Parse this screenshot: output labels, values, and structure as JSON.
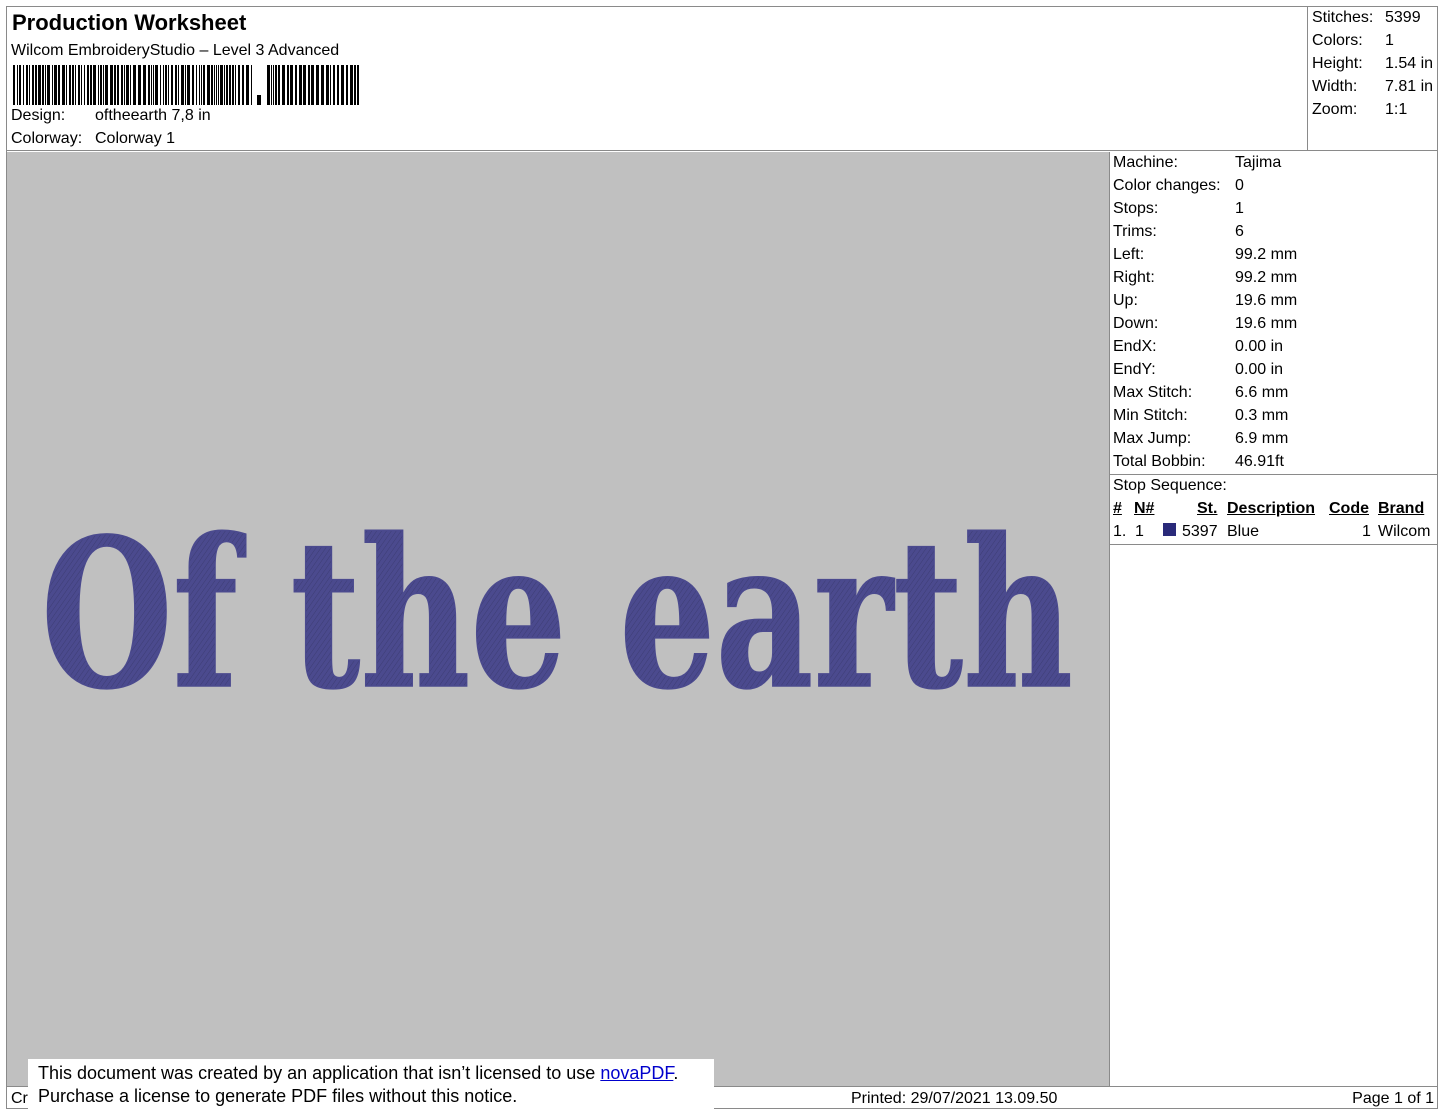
{
  "header": {
    "title": "Production Worksheet",
    "subtitle": "Wilcom EmbroideryStudio – Level 3 Advanced",
    "design_label": "Design:",
    "design_value": "oftheearth 7,8 in",
    "colorway_label": "Colorway:",
    "colorway_value": "Colorway 1"
  },
  "summary": {
    "stitches_label": "Stitches:",
    "stitches_value": "5399",
    "colors_label": "Colors:",
    "colors_value": "1",
    "height_label": "Height:",
    "height_value": "1.54 in",
    "width_label": "Width:",
    "width_value": "7.81 in",
    "zoom_label": "Zoom:",
    "zoom_value": "1:1"
  },
  "machine_info": [
    {
      "label": "Machine:",
      "value": "Tajima"
    },
    {
      "label": "Color changes:",
      "value": "0"
    },
    {
      "label": "Stops:",
      "value": "1"
    },
    {
      "label": "Trims:",
      "value": "6"
    },
    {
      "label": "Left:",
      "value": "99.2 mm"
    },
    {
      "label": "Right:",
      "value": "99.2 mm"
    },
    {
      "label": "Up:",
      "value": "19.6 mm"
    },
    {
      "label": "Down:",
      "value": "19.6 mm"
    },
    {
      "label": "EndX:",
      "value": "0.00 in"
    },
    {
      "label": "EndY:",
      "value": "0.00 in"
    },
    {
      "label": "Max Stitch:",
      "value": "6.6 mm"
    },
    {
      "label": "Min Stitch:",
      "value": "0.3 mm"
    },
    {
      "label": "Max Jump:",
      "value": "6.9 mm"
    },
    {
      "label": "Total Bobbin:",
      "value": "46.91ft"
    }
  ],
  "stop_sequence": {
    "title": "Stop Sequence:",
    "headers": {
      "num": "#",
      "n": "N#",
      "st": "St.",
      "description": "Description",
      "code": "Code",
      "brand": "Brand"
    },
    "rows": [
      {
        "num": "1.",
        "n": "1",
        "color": "#2a2a7a",
        "st": "5397",
        "description": "Blue",
        "code": "1",
        "brand": "Wilcom"
      }
    ]
  },
  "design": {
    "text": "Of the earth",
    "thread_color": "#4b4a8e",
    "background_color": "#c0c0c0"
  },
  "footer": {
    "left": "Cr",
    "printed": "Printed: 29/07/2021 13.09.50",
    "page": "Page 1 of 1"
  },
  "notice": {
    "line1_prefix": "This document was created by an application that isn’t licensed to use ",
    "link": "novaPDF",
    "line1_suffix": ".",
    "line2": "Purchase a license to generate PDF files without this notice."
  }
}
